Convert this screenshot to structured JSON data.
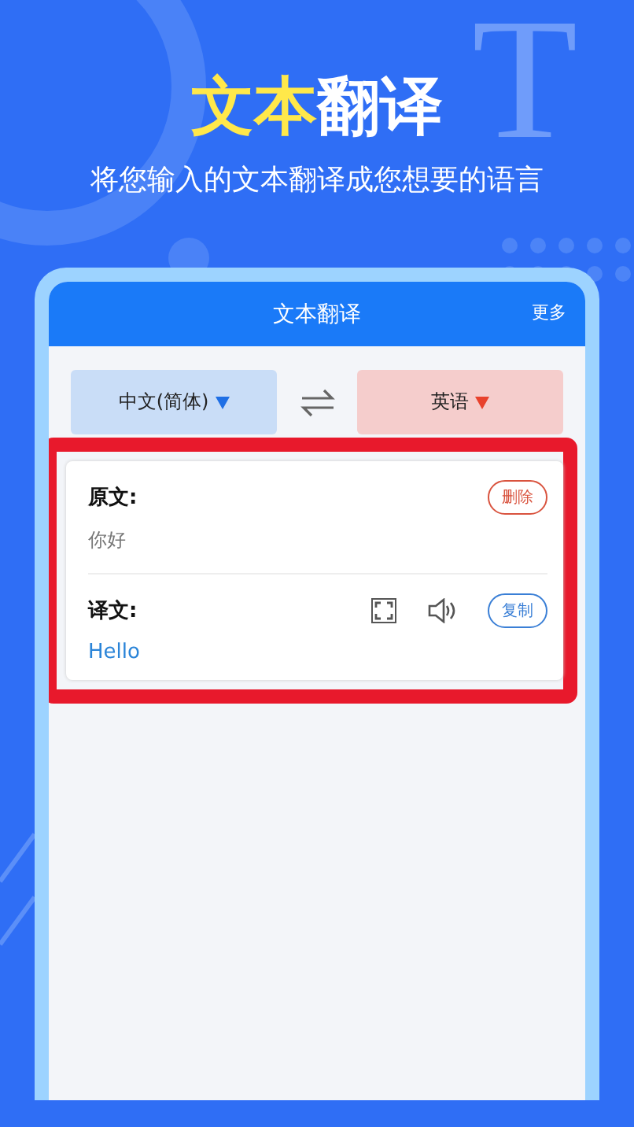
{
  "hero": {
    "title_highlight": "文本",
    "title_rest": "翻译",
    "subtitle": "将您输入的文本翻译成您想要的语言",
    "decor_letter": "T"
  },
  "app": {
    "title": "文本翻译",
    "more": "更多",
    "languages": [
      {
        "label": "中文(简体)",
        "color": "#1f6fe5"
      },
      {
        "label": "英语",
        "color": "#e8412c"
      }
    ],
    "source": {
      "label": "原文:",
      "text": "你好",
      "delete": "删除"
    },
    "result": {
      "label": "译文:",
      "text": "Hello",
      "copy": "复制"
    }
  }
}
